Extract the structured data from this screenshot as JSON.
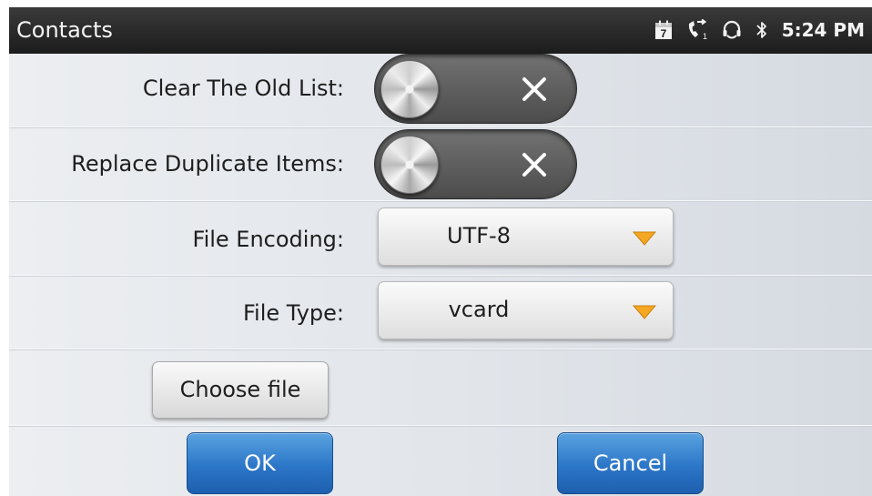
{
  "status_bar": {
    "title": "Contacts",
    "time": "5:24 PM",
    "calendar_day": "7",
    "icons": [
      "calendar-icon",
      "call-forward-icon",
      "headset-icon",
      "bluetooth-icon"
    ]
  },
  "form": {
    "clear_old_list": {
      "label": "Clear The Old List:",
      "enabled": false
    },
    "replace_duplicates": {
      "label": "Replace Duplicate Items:",
      "enabled": false
    },
    "file_encoding": {
      "label": "File Encoding:",
      "value": "UTF-8"
    },
    "file_type": {
      "label": "File Type:",
      "value": "vcard"
    },
    "choose_file_label": "Choose file"
  },
  "actions": {
    "ok_label": "OK",
    "cancel_label": "Cancel"
  },
  "colors": {
    "accent_blue": "#2c76c8",
    "dropdown_arrow": "#f5a623",
    "status_bar": "#262626"
  }
}
